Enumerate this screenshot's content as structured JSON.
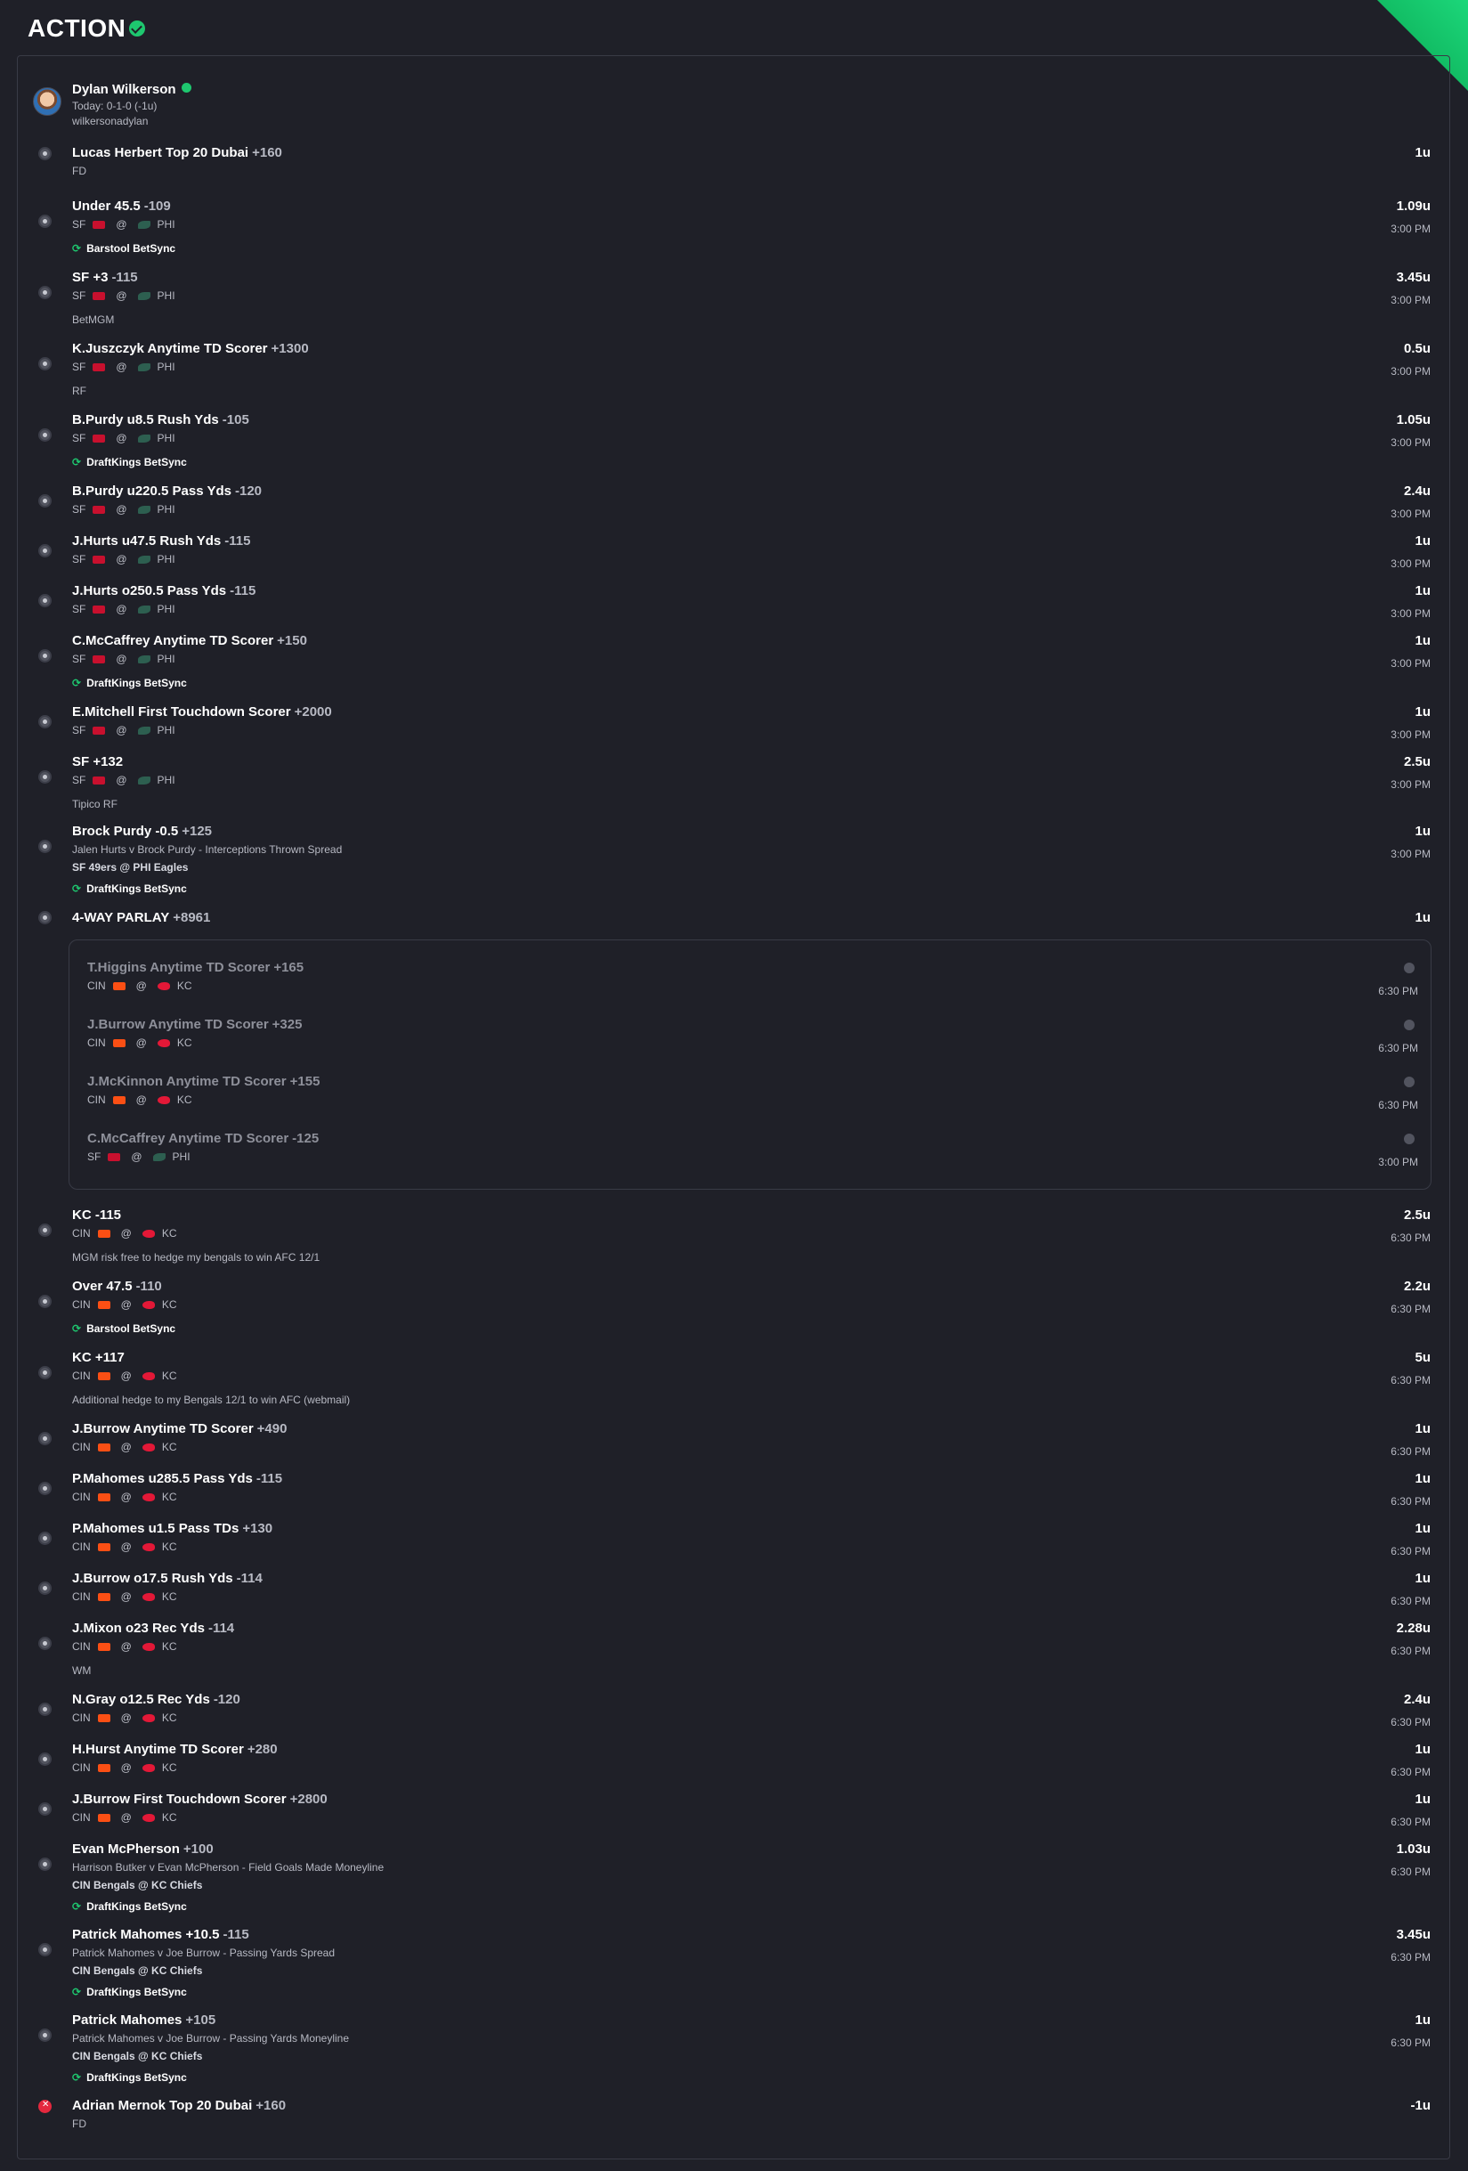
{
  "app": {
    "logo_text": "ACTION"
  },
  "profile": {
    "name": "Dylan Wilkerson",
    "record": "Today: 0-1-0 (-1u)",
    "handle": "wilkersonadylan"
  },
  "bets": [
    {
      "title": "Lucas Herbert Top 20 Dubai",
      "odds": "+160",
      "units": "1u",
      "note": "FD"
    },
    {
      "title": "Under 45.5",
      "odds": "-109",
      "units": "1.09u",
      "time": "3:00 PM",
      "away": "SF",
      "home": "PHI",
      "sync": "Barstool BetSync"
    },
    {
      "title": "SF +3",
      "odds": "-115",
      "units": "3.45u",
      "time": "3:00 PM",
      "away": "SF",
      "home": "PHI",
      "note": "BetMGM"
    },
    {
      "title": "K.Juszczyk Anytime TD Scorer",
      "odds": "+1300",
      "units": "0.5u",
      "time": "3:00 PM",
      "away": "SF",
      "home": "PHI",
      "note": "RF"
    },
    {
      "title": "B.Purdy u8.5 Rush Yds",
      "odds": "-105",
      "units": "1.05u",
      "time": "3:00 PM",
      "away": "SF",
      "home": "PHI",
      "sync": "DraftKings BetSync"
    },
    {
      "title": "B.Purdy u220.5 Pass Yds",
      "odds": "-120",
      "units": "2.4u",
      "time": "3:00 PM",
      "away": "SF",
      "home": "PHI"
    },
    {
      "title": "J.Hurts u47.5 Rush Yds",
      "odds": "-115",
      "units": "1u",
      "time": "3:00 PM",
      "away": "SF",
      "home": "PHI"
    },
    {
      "title": "J.Hurts o250.5 Pass Yds",
      "odds": "-115",
      "units": "1u",
      "time": "3:00 PM",
      "away": "SF",
      "home": "PHI"
    },
    {
      "title": "C.McCaffrey Anytime TD Scorer",
      "odds": "+150",
      "units": "1u",
      "time": "3:00 PM",
      "away": "SF",
      "home": "PHI",
      "sync": "DraftKings BetSync"
    },
    {
      "title": "E.Mitchell First Touchdown Scorer",
      "odds": "+2000",
      "units": "1u",
      "time": "3:00 PM",
      "away": "SF",
      "home": "PHI"
    },
    {
      "title": "SF +132",
      "odds": "",
      "units": "2.5u",
      "time": "3:00 PM",
      "away": "SF",
      "home": "PHI",
      "note": "Tipico RF"
    },
    {
      "title": "Brock Purdy -0.5",
      "odds": "+125",
      "units": "1u",
      "time": "3:00 PM",
      "desc": "Jalen Hurts v Brock Purdy - Interceptions Thrown Spread",
      "game": "SF 49ers @ PHI Eagles",
      "sync": "DraftKings BetSync"
    },
    {
      "title": "4-WAY PARLAY",
      "odds": "+8961",
      "units": "1u"
    },
    {
      "title": "KC -115",
      "odds": "",
      "units": "2.5u",
      "time": "6:30 PM",
      "away": "CIN",
      "home": "KC",
      "note": "MGM risk free to hedge my bengals to win AFC 12/1"
    },
    {
      "title": "Over 47.5",
      "odds": "-110",
      "units": "2.2u",
      "time": "6:30 PM",
      "away": "CIN",
      "home": "KC",
      "sync": "Barstool BetSync"
    },
    {
      "title": "KC +117",
      "odds": "",
      "units": "5u",
      "time": "6:30 PM",
      "away": "CIN",
      "home": "KC",
      "note": "Additional hedge to my Bengals 12/1 to win AFC (webmail)"
    },
    {
      "title": "J.Burrow Anytime TD Scorer",
      "odds": "+490",
      "units": "1u",
      "time": "6:30 PM",
      "away": "CIN",
      "home": "KC"
    },
    {
      "title": "P.Mahomes u285.5 Pass Yds",
      "odds": "-115",
      "units": "1u",
      "time": "6:30 PM",
      "away": "CIN",
      "home": "KC"
    },
    {
      "title": "P.Mahomes u1.5 Pass TDs",
      "odds": "+130",
      "units": "1u",
      "time": "6:30 PM",
      "away": "CIN",
      "home": "KC"
    },
    {
      "title": "J.Burrow o17.5 Rush Yds",
      "odds": "-114",
      "units": "1u",
      "time": "6:30 PM",
      "away": "CIN",
      "home": "KC"
    },
    {
      "title": "J.Mixon o23 Rec Yds",
      "odds": "-114",
      "units": "2.28u",
      "time": "6:30 PM",
      "away": "CIN",
      "home": "KC",
      "note": "WM"
    },
    {
      "title": "N.Gray o12.5 Rec Yds",
      "odds": "-120",
      "units": "2.4u",
      "time": "6:30 PM",
      "away": "CIN",
      "home": "KC"
    },
    {
      "title": "H.Hurst Anytime TD Scorer",
      "odds": "+280",
      "units": "1u",
      "time": "6:30 PM",
      "away": "CIN",
      "home": "KC"
    },
    {
      "title": "J.Burrow First Touchdown Scorer",
      "odds": "+2800",
      "units": "1u",
      "time": "6:30 PM",
      "away": "CIN",
      "home": "KC"
    },
    {
      "title": "Evan McPherson",
      "odds": "+100",
      "units": "1.03u",
      "time": "6:30 PM",
      "desc": "Harrison Butker v Evan McPherson - Field Goals Made Moneyline",
      "game": "CIN Bengals @ KC Chiefs",
      "sync": "DraftKings BetSync"
    },
    {
      "title": "Patrick Mahomes +10.5",
      "odds": "-115",
      "units": "3.45u",
      "time": "6:30 PM",
      "desc": "Patrick Mahomes v Joe Burrow - Passing Yards Spread",
      "game": "CIN Bengals @ KC Chiefs",
      "sync": "DraftKings BetSync"
    },
    {
      "title": "Patrick Mahomes",
      "odds": "+105",
      "units": "1u",
      "time": "6:30 PM",
      "desc": "Patrick Mahomes v Joe Burrow - Passing Yards Moneyline",
      "game": "CIN Bengals @ KC Chiefs",
      "sync": "DraftKings BetSync"
    },
    {
      "title": "Adrian Mernok Top 20 Dubai",
      "odds": "+160",
      "units": "-1u",
      "note": "FD",
      "status": "loss"
    }
  ],
  "parlay_legs": [
    {
      "title": "T.Higgins Anytime TD Scorer",
      "odds": "+165",
      "away": "CIN",
      "home": "KC",
      "time": "6:30 PM"
    },
    {
      "title": "J.Burrow Anytime TD Scorer",
      "odds": "+325",
      "away": "CIN",
      "home": "KC",
      "time": "6:30 PM"
    },
    {
      "title": "J.McKinnon Anytime TD Scorer",
      "odds": "+155",
      "away": "CIN",
      "home": "KC",
      "time": "6:30 PM"
    },
    {
      "title": "C.McCaffrey Anytime TD Scorer",
      "odds": "-125",
      "away": "SF",
      "home": "PHI",
      "time": "3:00 PM"
    }
  ],
  "at_symbol": "@",
  "colors": {
    "background": "#1f2028",
    "accent": "#1ec76f",
    "loss": "#e4283e",
    "muted_text": "#b7b9c3"
  },
  "icons": {
    "sync": "refresh-icon",
    "verified": "check-badge-icon"
  }
}
